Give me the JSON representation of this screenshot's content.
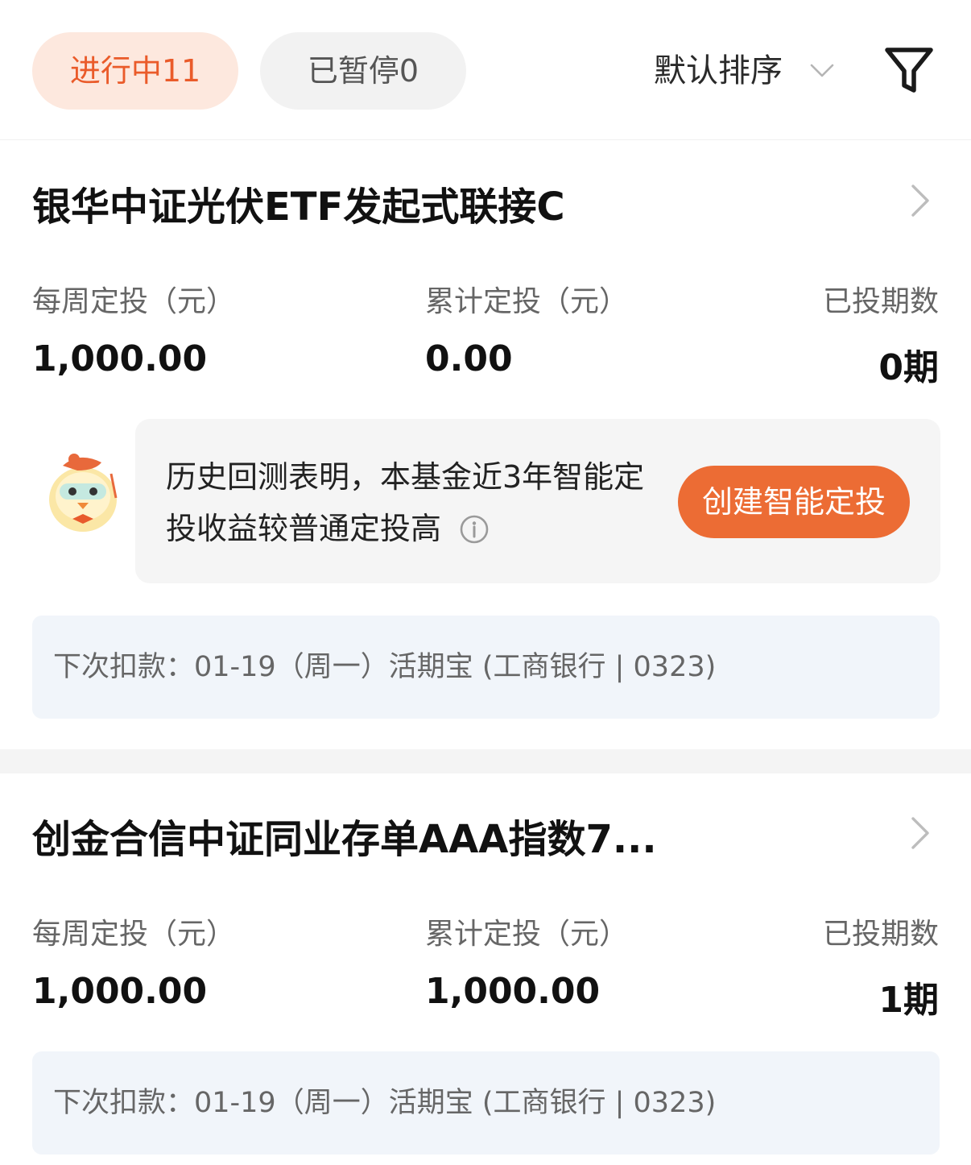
{
  "tabs": {
    "active_label": "进行中11",
    "paused_label": "已暂停0"
  },
  "sort": {
    "label": "默认排序"
  },
  "icons": {
    "filter": "filter-icon",
    "chevron_down": "chevron-down-icon",
    "chevron_right": "chevron-right-icon",
    "info": "info-icon",
    "mascot": "mascot-icon"
  },
  "colors": {
    "accent": "#ea5b2a",
    "button": "#ec6c34",
    "active_tab_bg": "#fde8de"
  },
  "plans": [
    {
      "fund_name": "银华中证光伏ETF发起式联接C",
      "weekly_label": "每周定投（元）",
      "weekly_value": "1,000.00",
      "total_label": "累计定投（元）",
      "total_value": "0.00",
      "periods_label": "已投期数",
      "periods_value": "0期",
      "tip": {
        "text": "历史回测表明，本基金近3年智能定投收益较普通定投高",
        "button_label": "创建智能定投"
      },
      "next_deduction": "下次扣款：01-19（周一）活期宝 (工商银行 | 0323)"
    },
    {
      "fund_name": "创金合信中证同业存单AAA指数7...",
      "weekly_label": "每周定投（元）",
      "weekly_value": "1,000.00",
      "total_label": "累计定投（元）",
      "total_value": "1,000.00",
      "periods_label": "已投期数",
      "periods_value": "1期",
      "next_deduction": "下次扣款：01-19（周一）活期宝 (工商银行 | 0323)"
    }
  ]
}
